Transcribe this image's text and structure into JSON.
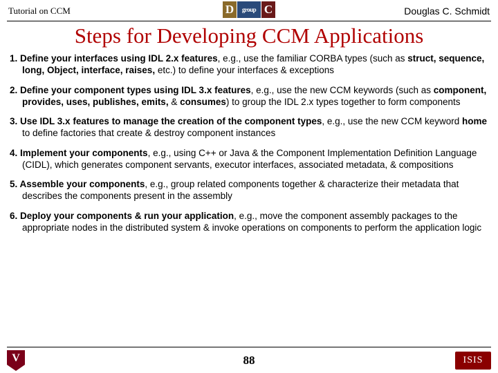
{
  "header": {
    "left": "Tutorial on CCM",
    "right": "Douglas C. Schmidt",
    "logo_d": "D",
    "logo_group": "group",
    "logo_c": "C"
  },
  "title": "Steps for Developing CCM Applications",
  "steps": [
    {
      "lead": "Define your interfaces using IDL 2.x features",
      "tail_a": ", e.g., use the familiar CORBA types (such as ",
      "kws": "struct, sequence, long, Object, interface, raises,",
      "tail_b": " etc.) to define your interfaces & exceptions"
    },
    {
      "lead": "Define your component types using IDL 3.x features",
      "tail_a": ", e.g., use the new CCM keywords (such as ",
      "kws": "component, provides, uses, publishes, emits, ",
      "amp": "& ",
      "kws2": "consumes",
      "tail_b": ") to group the IDL 2.x types together to form components"
    },
    {
      "lead": "Use IDL 3.x features to manage the creation of the component types",
      "tail_a": ", e.g., use the new CCM keyword ",
      "kws": "home",
      "tail_b": " to define factories that create & destroy component instances"
    },
    {
      "lead": "Implement your components",
      "tail_a": ", e.g., using C++ or Java & the Component Implementation Definition Language (CIDL), which generates component servants, executor interfaces, associated metadata, & compositions"
    },
    {
      "lead": "Assemble your components",
      "tail_a": ", e.g., group related components together & characterize their metadata that describes the components present in the assembly"
    },
    {
      "lead": "Deploy your components & run your application",
      "tail_a": ", e.g., move the component assembly packages to the appropriate nodes in the distributed system & invoke operations on components to perform the application logic"
    }
  ],
  "footer": {
    "page": "88",
    "isis": "ISIS"
  }
}
